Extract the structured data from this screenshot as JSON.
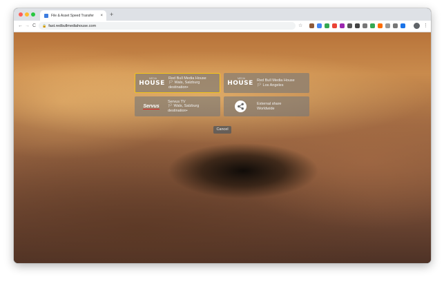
{
  "browser": {
    "tab_title": "File & Asset Speed Transfer",
    "tab_close": "×",
    "new_tab": "+",
    "url": "fast.redbullmediahouse.com",
    "nav": {
      "back": "←",
      "forward": "→",
      "reload": "C"
    },
    "star": "☆",
    "menu": "⋮",
    "extension_colors": [
      "#8e5a3a",
      "#4285f4",
      "#34a853",
      "#ea4335",
      "#9c27b0",
      "#555555",
      "#444444",
      "#777777",
      "#34a853",
      "#ff6d00",
      "#999999",
      "#777777",
      "#1a73e8"
    ]
  },
  "destinations": [
    {
      "logo_brand": "MEDIA",
      "logo_text": "HOUSE",
      "name": "Red Bull Media House",
      "location": "Wals, Salzburg",
      "note": "destination•",
      "selected": true
    },
    {
      "logo_brand": "MEDIA",
      "logo_text": "HOUSE",
      "name": "Red Bull Media House",
      "location": "Los Angeles",
      "selected": false
    },
    {
      "logo_text": "Servus",
      "name": "Servus TV",
      "location": "Wals, Salzburg",
      "note": "destination•",
      "selected": false
    },
    {
      "name": "External share",
      "location": "Worldwide",
      "selected": false
    }
  ],
  "cancel_label": "Cancel",
  "colors": {
    "selected_border": "#f5c518",
    "card_bg": "rgba(120,120,120,0.62)"
  }
}
